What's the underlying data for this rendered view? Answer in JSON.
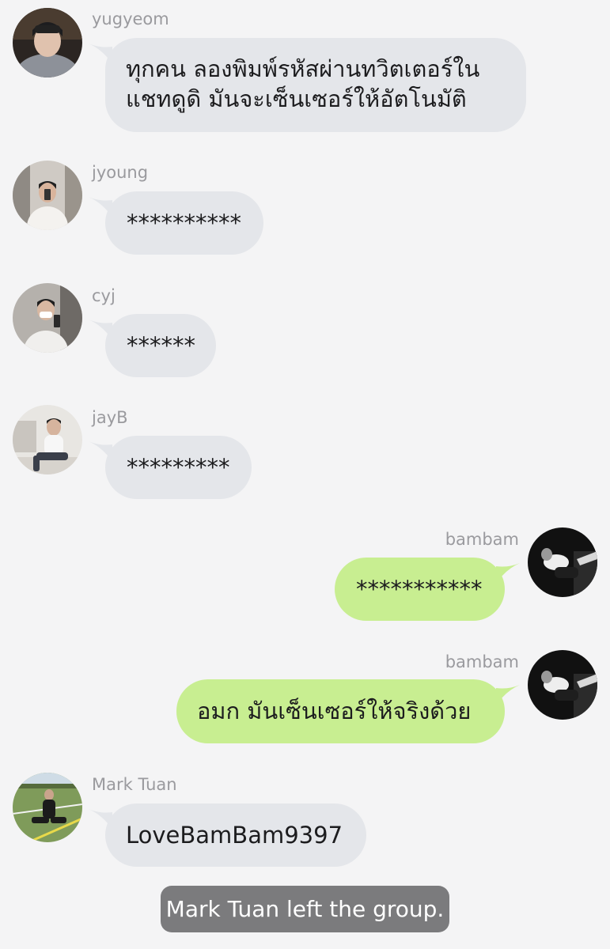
{
  "messages": [
    {
      "sender": "yugyeom",
      "text_line1": "ทุกคน ลองพิมพ์รหัสผ่านทวิตเตอร์ใน",
      "text_line2": "แชทดูดิ มันจะเซ็นเซอร์ให้อัตโนมัติ",
      "direction": "incoming"
    },
    {
      "sender": "jyoung",
      "text": "**********",
      "direction": "incoming"
    },
    {
      "sender": "cyj",
      "text": "******",
      "direction": "incoming"
    },
    {
      "sender": "jayB",
      "text": "*********",
      "direction": "incoming"
    },
    {
      "sender": "bambam",
      "text": "***********",
      "direction": "outgoing"
    },
    {
      "sender": "bambam",
      "text": "อมก มันเซ็นเซอร์ให้จริงด้วย",
      "direction": "outgoing"
    },
    {
      "sender": "Mark Tuan",
      "text": "LoveBamBam9397",
      "direction": "incoming"
    }
  ],
  "system_notice": "Mark Tuan left the group.",
  "colors": {
    "background": "#f4f4f5",
    "incoming_bubble": "#e4e6ea",
    "outgoing_bubble": "#c8ee91",
    "system_bubble": "#7b7b7d",
    "sender_name": "#9a9a9e"
  }
}
